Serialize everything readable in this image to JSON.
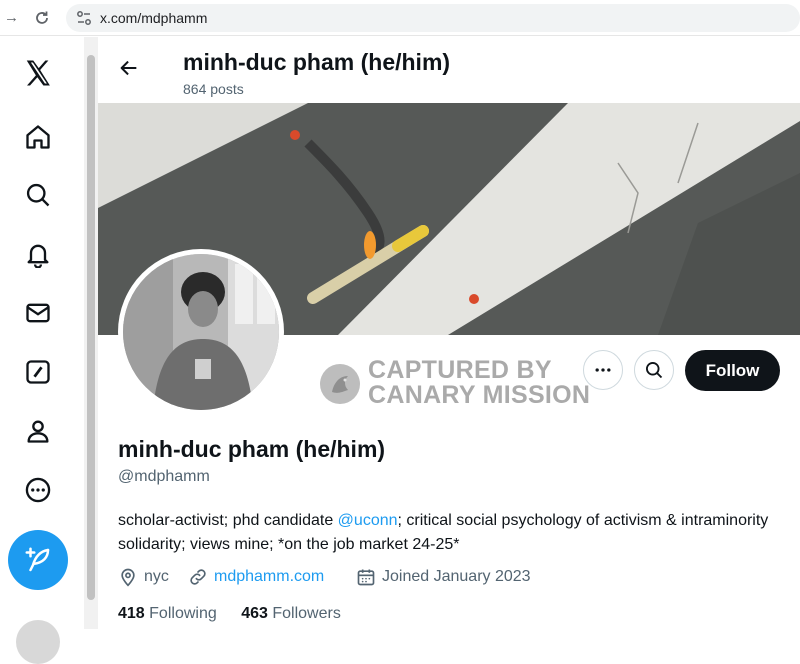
{
  "browser": {
    "url": "x.com/mdphamm"
  },
  "sidebar": {
    "items": [
      {
        "icon": "x-logo-icon"
      },
      {
        "icon": "home-icon"
      },
      {
        "icon": "search-icon"
      },
      {
        "icon": "bell-icon"
      },
      {
        "icon": "mail-icon"
      },
      {
        "icon": "grok-icon"
      },
      {
        "icon": "profile-icon"
      },
      {
        "icon": "more-icon"
      }
    ],
    "compose_icon": "feather-plus-icon"
  },
  "header": {
    "title": "minh-duc pham (he/him)",
    "posts": "864 posts"
  },
  "watermark": {
    "line1": "CAPTURED BY",
    "line2": "CANARY MISSION"
  },
  "actions": {
    "follow_label": "Follow"
  },
  "profile": {
    "name": "minh-duc pham (he/him)",
    "handle": "@mdphamm",
    "bio_before": "scholar-activist; phd candidate ",
    "bio_mention": "@uconn",
    "bio_after": "; critical social psychology of activism & intraminority solidarity; views mine; *on the job market 24-25*",
    "location": "nyc",
    "website": "mdphamm.com",
    "joined": "Joined January 2023",
    "following_count": "418",
    "following_label": "Following",
    "followers_count": "463",
    "followers_label": "Followers"
  },
  "colors": {
    "accent": "#1d9bf0",
    "text": "#0f1419",
    "muted": "#536471"
  }
}
